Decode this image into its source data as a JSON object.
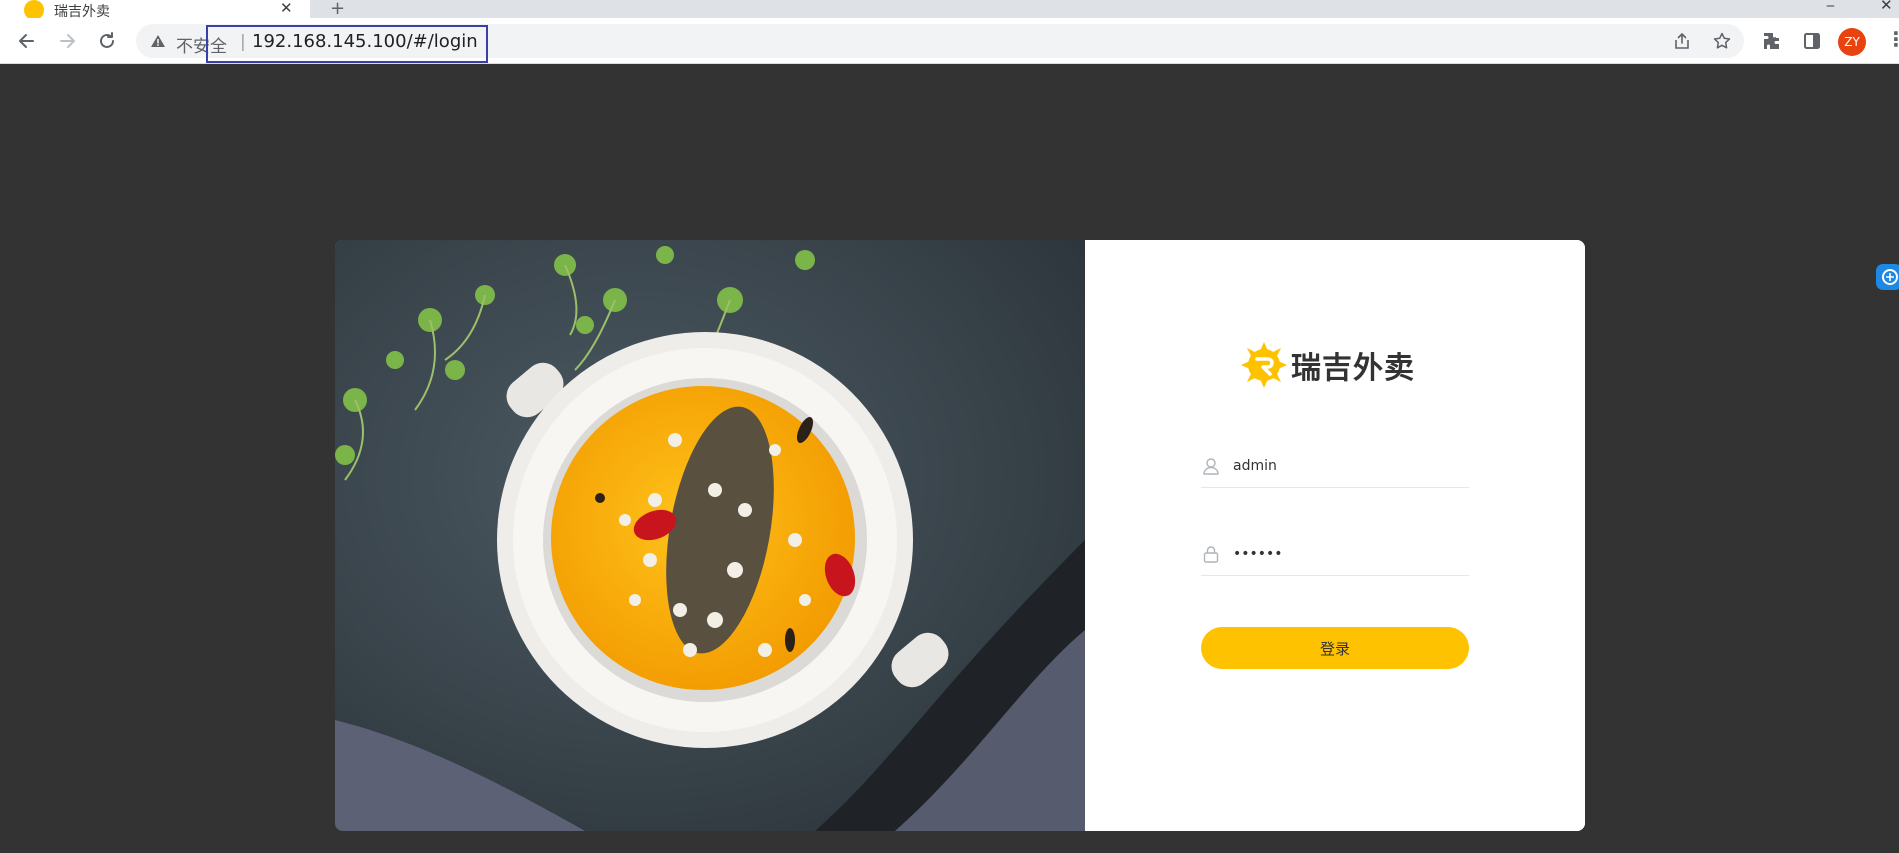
{
  "browser": {
    "tab_title": "瑞吉外卖",
    "tab_close": "✕",
    "new_tab": "+",
    "window_minimize": "‒",
    "window_close": "✕",
    "security_label": "不安全",
    "separator": "|",
    "url": "192.168.145.100/#/login",
    "profile_initials": "ZY",
    "menu": "⋮",
    "icons": [
      "back-icon",
      "forward-icon",
      "reload-icon",
      "warning-icon",
      "share-icon",
      "star-icon",
      "extensions-icon",
      "side-panel-icon",
      "translate-extension-icon"
    ],
    "highlight_color": "#3b3fa8"
  },
  "login": {
    "brand_name": "瑞吉外卖",
    "username": {
      "value": "admin",
      "icon": "user-icon"
    },
    "password": {
      "value": "123456",
      "icon": "lock-icon"
    },
    "submit_label": "登录",
    "accent_color": "#ffc200",
    "hero_image": "soup-bowl-photo"
  }
}
